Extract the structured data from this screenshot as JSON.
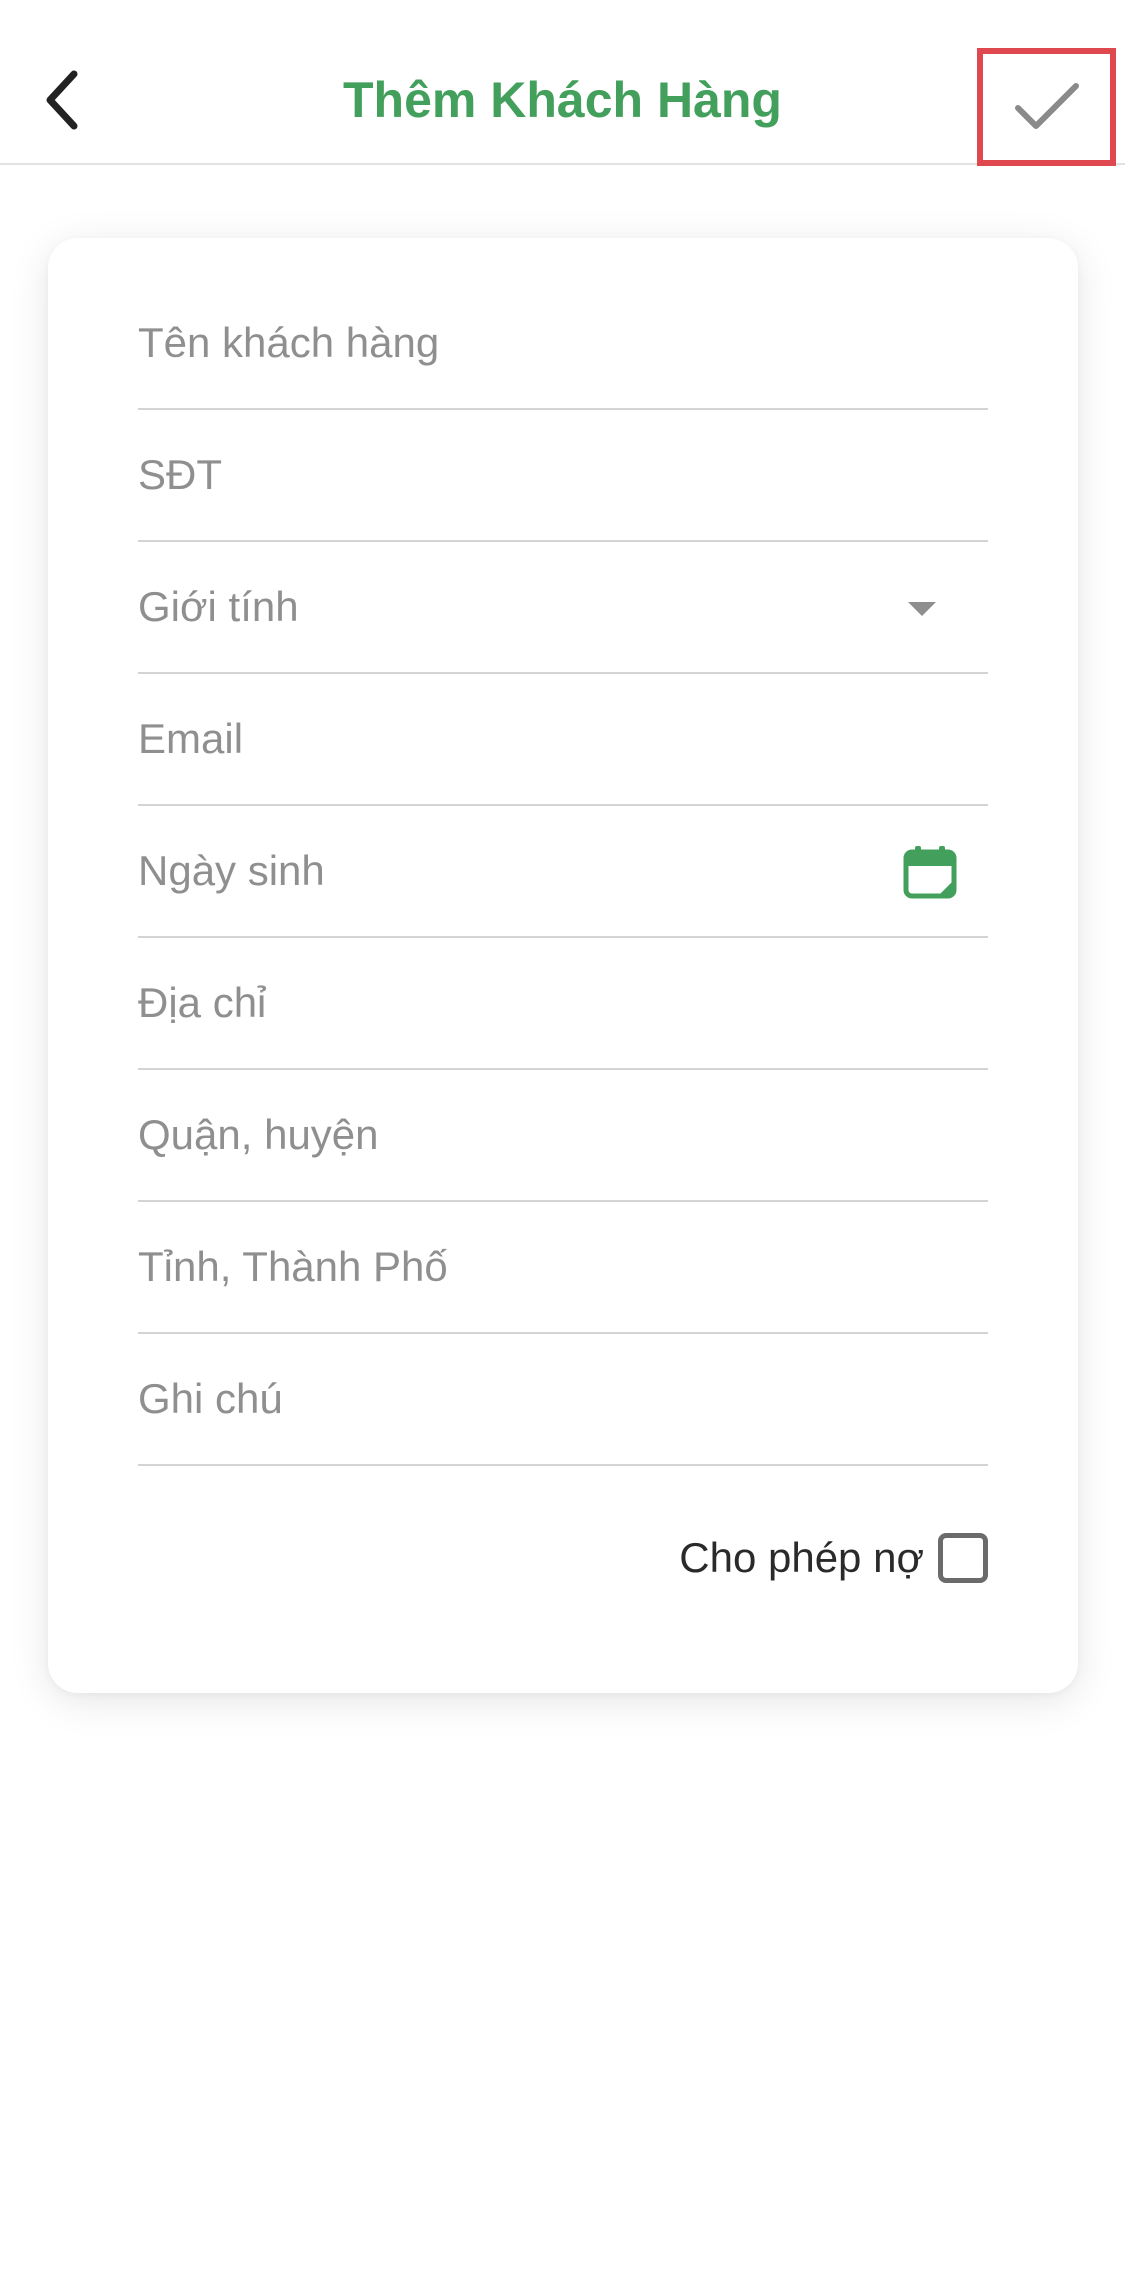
{
  "header": {
    "title": "Thêm Khách Hàng"
  },
  "form": {
    "customer_name_placeholder": "Tên khách hàng",
    "phone_placeholder": "SĐT",
    "gender_placeholder": "Giới tính",
    "email_placeholder": "Email",
    "birthday_placeholder": "Ngày sinh",
    "address_placeholder": "Địa chỉ",
    "district_placeholder": "Quận, huyện",
    "province_placeholder": "Tỉnh, Thành Phố",
    "note_placeholder": "Ghi chú",
    "allow_debt_label": "Cho phép nợ",
    "allow_debt_checked": false
  },
  "icons": {
    "back": "chevron-left-icon",
    "confirm": "checkmark-icon",
    "gender_dropdown": "caret-down-icon",
    "birthday": "calendar-icon"
  },
  "colors": {
    "accent": "#43a05c",
    "highlight_border": "#e0484f",
    "placeholder": "#8f8f8f",
    "divider": "#d4d4d4"
  }
}
